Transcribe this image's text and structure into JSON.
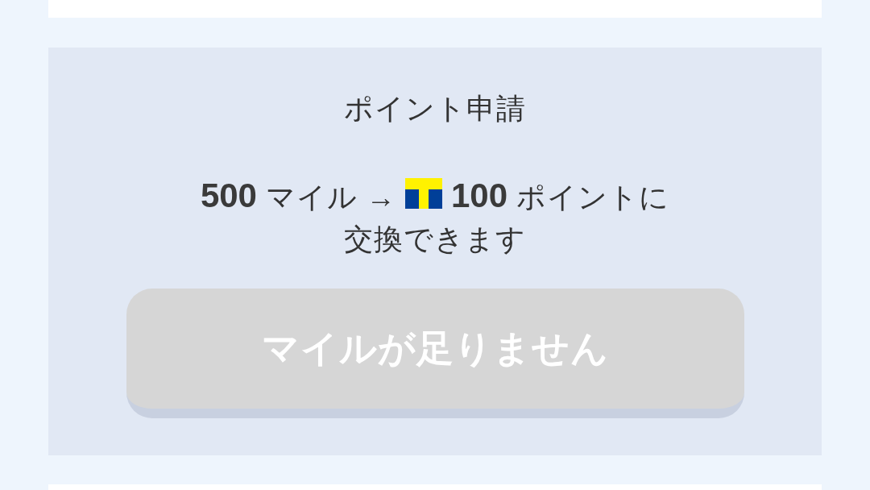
{
  "panel": {
    "title": "ポイント申請",
    "message": {
      "lead": "**500** マイル →",
      "tail": "**100** ポイントに交換できます"
    },
    "button": {
      "label": "マイルが足りません",
      "disabled": true
    }
  }
}
